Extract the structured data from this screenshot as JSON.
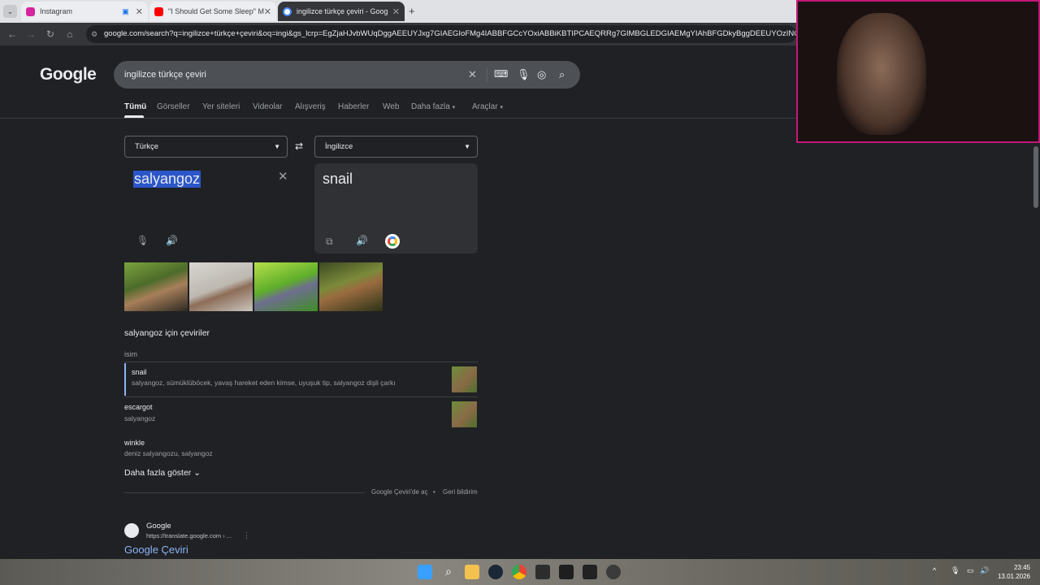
{
  "browser": {
    "tabs": [
      {
        "title": "Instagram",
        "favicon_color": "#d6249f"
      },
      {
        "title": "\"I Should Get Some Sleep\" Men",
        "favicon_color": "#ff0000"
      },
      {
        "title": "ingilizce türkçe çeviri - Google",
        "favicon_color": "#4285f4"
      }
    ],
    "new_tab_label": "+",
    "url": "google.com/search?q=ingilizce+türkçe+çeviri&oq=ingi&gs_lcrp=EgZjaHJvbWUqDggAEEUYJxg7GIAEGIoFMg4IABBFGCcYOxiABBiKBTIPCAEQRRg7GIMBGLEDGIAEMgYIAhBFGDkyBggDEEUYOzINCAQQABiDAR"
  },
  "google": {
    "logo": "Google",
    "query": "ingilizce türkçe çeviri",
    "nav_tabs": [
      "Tümü",
      "Görseller",
      "Yer siteleri",
      "Videolar",
      "Alışveriş",
      "Haberler",
      "Web",
      "Daha fazla",
      "Araçlar"
    ],
    "active_tab": "Tümü"
  },
  "translate": {
    "source_lang": "Türkçe",
    "target_lang": "İngilizce",
    "source_text": "salyangoz",
    "target_text": "snail",
    "section_title": "salyangoz için çeviriler",
    "pos": "isim",
    "rows": [
      {
        "term": "snail",
        "synonyms": "salyangoz, sümüklüböcek, yavaş hareket eden kimse, uyuşuk tip, salyangoz dişli çarkı",
        "has_thumb": true
      },
      {
        "term": "escargot",
        "synonyms": "salyangoz",
        "has_thumb": true
      },
      {
        "term": "winkle",
        "synonyms": "deniz salyangozu, salyangoz",
        "has_thumb": false
      }
    ],
    "show_more": "Daha fazla göster",
    "open_in_translate": "Google Çeviri'de aç",
    "feedback": "Geri bildirim"
  },
  "result": {
    "site_name": "Google",
    "site_url": "https://translate.google.com › ...",
    "title": "Google Çeviri"
  },
  "taskbar": {
    "time": "23:45",
    "date": "13.01.2026"
  }
}
